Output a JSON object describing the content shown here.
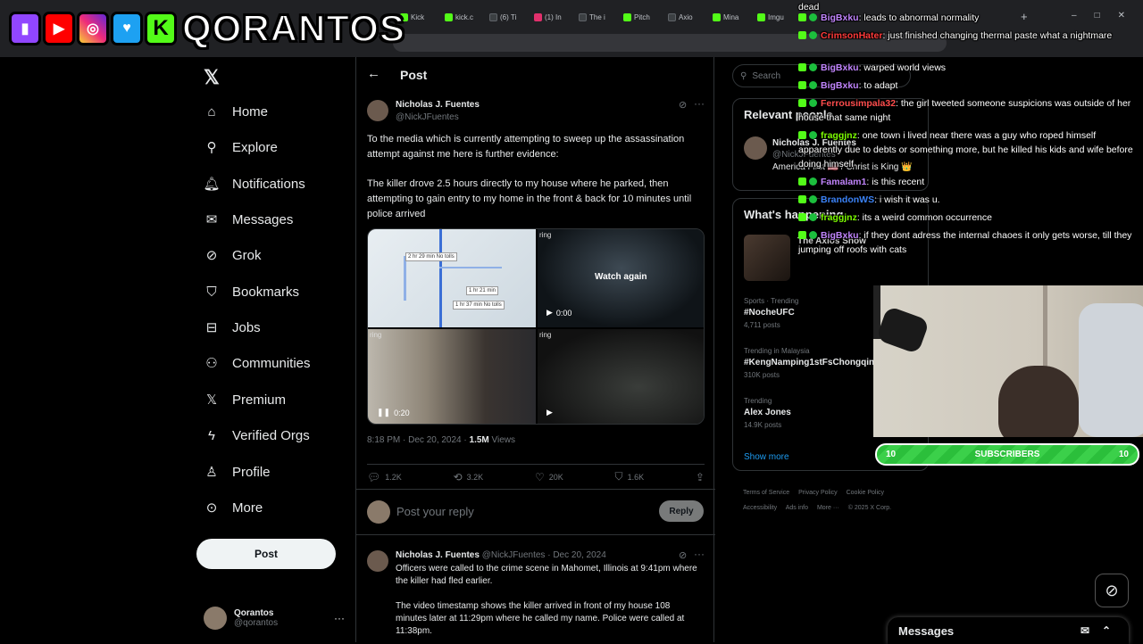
{
  "browser": {
    "tabs": [
      "Kick",
      "kick.c",
      "(6) Ti",
      "(1) In",
      "The i",
      "Pitch",
      "Axio",
      "Mina",
      "Imgu"
    ],
    "new_tab": "+",
    "window_controls": [
      "–",
      "□",
      "✕"
    ]
  },
  "stream": {
    "brand": "QORANTOS",
    "logos": [
      "twitch-logo",
      "youtube-logo",
      "instagram-logo",
      "twitter-logo",
      "kick-logo"
    ],
    "subscribers": {
      "label": "SUBSCRIBERS",
      "left_count": "10",
      "right_count": "10"
    }
  },
  "chat": [
    {
      "user": "",
      "text": "dead",
      "color": "#ffffff"
    },
    {
      "user": "BigBxku",
      "text": ": leads to abnormal normality",
      "color": "#c084fc"
    },
    {
      "user": "CrimsonHater",
      "text": ": just finished changing thermal paste what a nightmare",
      "color": "#ff3b3b"
    },
    {
      "user": "BigBxku",
      "text": ": warped world views",
      "color": "#c084fc"
    },
    {
      "user": "BigBxku",
      "text": ": to adapt",
      "color": "#c084fc"
    },
    {
      "user": "Ferrousimpala32",
      "text": ": the girl tweeted someone suspicions was outside of her house that same night",
      "color": "#ff4d4d"
    },
    {
      "user": "fraggjnz",
      "text": ": one town i lived near there was a guy who roped himself apparently due to debts or something more, but he killed his kids and wife before doing himself",
      "color": "#7cfc00"
    },
    {
      "user": "Famalam1",
      "text": ": is this recent",
      "color": "#c084fc"
    },
    {
      "user": "BrandonWS",
      "text": ": i wish it was u.",
      "color": "#3b82f6"
    },
    {
      "user": "fraggjnz",
      "text": ": its a weird common occurrence",
      "color": "#7cfc00"
    },
    {
      "user": "BigBxku",
      "text": ": if they dont adress the internal chaoes it only gets worse, till they jumping off roofs with cats",
      "color": "#c084fc"
    }
  ],
  "sidebar": {
    "items": [
      {
        "label": "Home",
        "icon": "home-icon"
      },
      {
        "label": "Explore",
        "icon": "search-icon"
      },
      {
        "label": "Notifications",
        "icon": "bell-icon"
      },
      {
        "label": "Messages",
        "icon": "envelope-icon"
      },
      {
        "label": "Grok",
        "icon": "grok-icon"
      },
      {
        "label": "Bookmarks",
        "icon": "bookmark-icon"
      },
      {
        "label": "Jobs",
        "icon": "briefcase-icon"
      },
      {
        "label": "Communities",
        "icon": "people-icon"
      },
      {
        "label": "Premium",
        "icon": "x-icon"
      },
      {
        "label": "Verified Orgs",
        "icon": "lightning-icon"
      },
      {
        "label": "Profile",
        "icon": "person-icon"
      },
      {
        "label": "More",
        "icon": "more-circle-icon"
      }
    ],
    "post_button": "Post",
    "account": {
      "name": "Qorantos",
      "handle": "@qorantos"
    }
  },
  "post": {
    "header": "Post",
    "author": "Nicholas J. Fuentes",
    "handle": "@NickJFuentes",
    "text1": "To the media which is currently attempting to sweep up the assassination attempt against me here is further evidence:",
    "text2": "The killer drove 2.5 hours directly to my house where he parked, then attempting to gain entry to my home in the front & back for 10 minutes until police arrived",
    "media": {
      "map_labels": [
        "2 hr 29 min No tolls",
        "1 hr 21 min",
        "1 hr 37 min No tolls"
      ],
      "ring_label": "ring",
      "watch_again": "Watch again",
      "video1_time": "0:00",
      "video2_time": "0:20"
    },
    "timestamp": "8:18 PM · Dec 20, 2024 · ",
    "views_count": "1.5M",
    "views_label": " Views",
    "stats": {
      "replies": "1.2K",
      "reposts": "3.2K",
      "likes": "20K",
      "bookmarks": "1.6K"
    },
    "reply_placeholder": "Post your reply",
    "reply_button": "Reply"
  },
  "reply_tweet": {
    "author": "Nicholas J. Fuentes",
    "meta": "@NickJFuentes · Dec 20, 2024",
    "text1": "Officers were called to the crime scene in Mahomet, Illinois at 9:41pm where the killer had fled earlier.",
    "text2": "The video timestamp shows the killer arrived in front of my house 108 minutes later at 11:29pm where he called my name. Police were called at 11:38pm."
  },
  "right": {
    "search_placeholder": "Search",
    "relevant_title": "Relevant people",
    "relevant": {
      "name": "Nicholas J. Fuentes",
      "handle": "@NickJFuentes",
      "bio": "America First 🇺🇸 / Christ is King 👑"
    },
    "happening_title": "What's happening",
    "happening_source": "The Axios Show",
    "trends": [
      {
        "context": "Sports · Trending",
        "title": "#NocheUFC",
        "posts": "4,711 posts"
      },
      {
        "context": "Trending in Malaysia",
        "title": "#KengNamping1stFsChongqing",
        "posts": "310K posts"
      },
      {
        "context": "Trending",
        "title": "Alex Jones",
        "posts": "14.9K posts"
      }
    ],
    "show_more": "Show more",
    "footer": [
      "Terms of Service",
      "Privacy Policy",
      "Cookie Policy",
      "Accessibility",
      "Ads info",
      "More ···",
      "© 2025 X Corp."
    ]
  },
  "messages_bar": {
    "label": "Messages"
  }
}
